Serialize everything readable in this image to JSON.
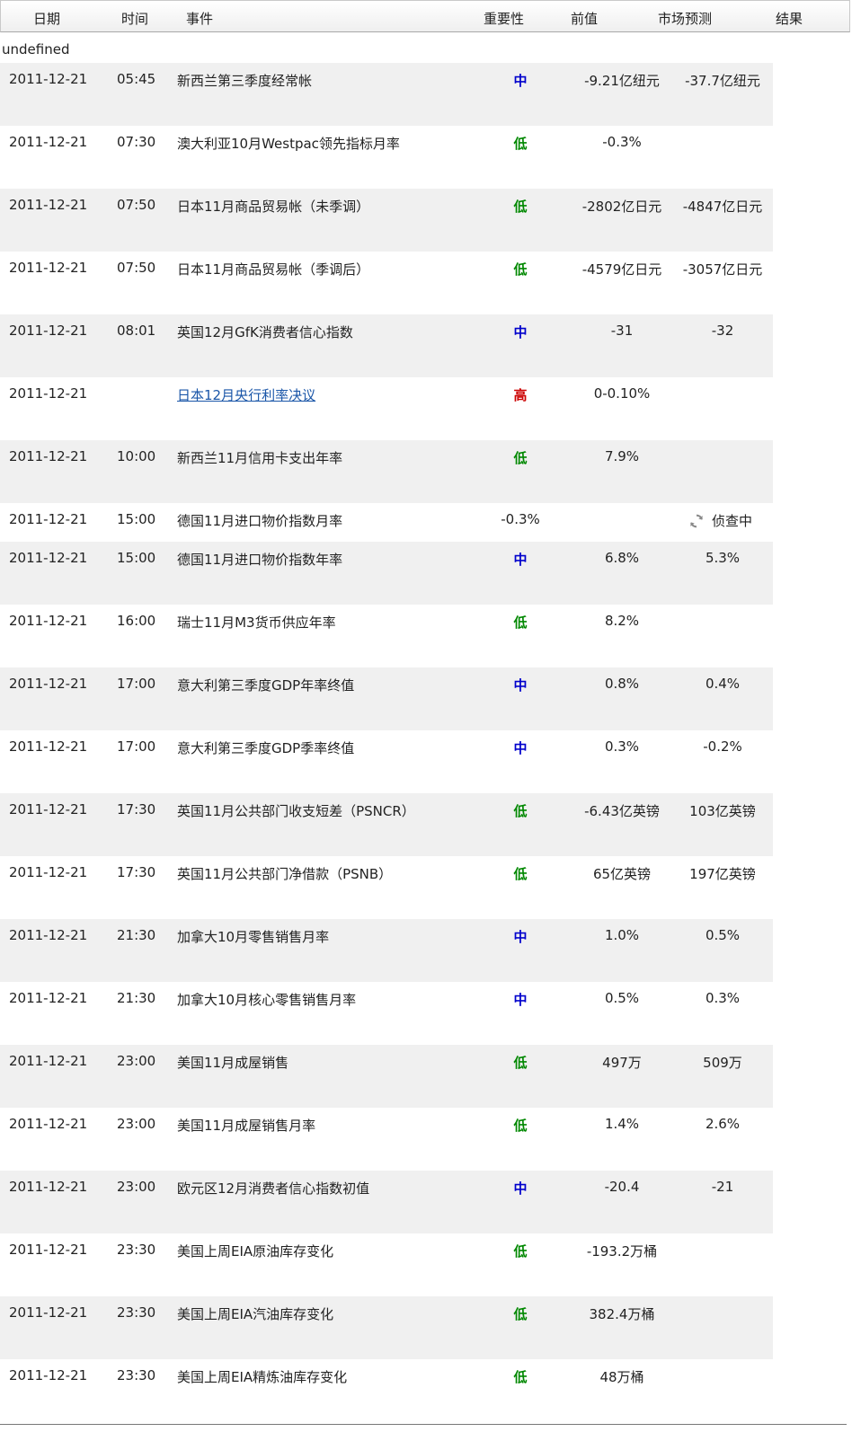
{
  "columns": {
    "date": "日期",
    "time": "时间",
    "event": "事件",
    "importance": "重要性",
    "previous": "前值",
    "forecast": "市场预测",
    "result": "结果"
  },
  "notice": "undefined",
  "colors": {
    "high": "#cc0000",
    "medium": "#0000cc",
    "low": "#008800",
    "link": "#1a56a8",
    "row_alt": "#f0f0f0"
  },
  "rows": [
    {
      "date": "2011-12-21",
      "time": "05:45",
      "event": "新西兰第三季度经常帐",
      "importance": "中",
      "level": "mid",
      "previous": "-9.21亿纽元",
      "forecast": "-37.7亿纽元",
      "result": ""
    },
    {
      "date": "2011-12-21",
      "time": "07:30",
      "event": "澳大利亚10月Westpac领先指标月率",
      "importance": "低",
      "level": "low",
      "previous": "-0.3%",
      "forecast": "",
      "result": ""
    },
    {
      "date": "2011-12-21",
      "time": "07:50",
      "event": "日本11月商品贸易帐（未季调）",
      "importance": "低",
      "level": "low",
      "previous": "-2802亿日元",
      "forecast": "-4847亿日元",
      "result": ""
    },
    {
      "date": "2011-12-21",
      "time": "07:50",
      "event": "日本11月商品贸易帐（季调后）",
      "importance": "低",
      "level": "low",
      "previous": "-4579亿日元",
      "forecast": "-3057亿日元",
      "result": ""
    },
    {
      "date": "2011-12-21",
      "time": "08:01",
      "event": "英国12月GfK消费者信心指数",
      "importance": "中",
      "level": "mid",
      "previous": "-31",
      "forecast": "-32",
      "result": ""
    },
    {
      "date": "2011-12-21",
      "time": "",
      "event": "日本12月央行利率决议",
      "importance": "高",
      "level": "high",
      "previous": "0-0.10%",
      "forecast": "",
      "result": "",
      "link": true
    },
    {
      "date": "2011-12-21",
      "time": "10:00",
      "event": "新西兰11月信用卡支出年率",
      "importance": "低",
      "level": "low",
      "previous": "7.9%",
      "forecast": "",
      "result": ""
    },
    {
      "date": "2011-12-21",
      "time": "15:00",
      "event": "德国11月进口物价指数月率",
      "importance": "-0.3%",
      "level": "plain",
      "previous": "",
      "forecast": "",
      "result": "侦查中",
      "pending": true
    },
    {
      "date": "2011-12-21",
      "time": "15:00",
      "event": "德国11月进口物价指数年率",
      "importance": "中",
      "level": "mid",
      "previous": "6.8%",
      "forecast": "5.3%",
      "result": ""
    },
    {
      "date": "2011-12-21",
      "time": "16:00",
      "event": "瑞士11月M3货币供应年率",
      "importance": "低",
      "level": "low",
      "previous": "8.2%",
      "forecast": "",
      "result": ""
    },
    {
      "date": "2011-12-21",
      "time": "17:00",
      "event": "意大利第三季度GDP年率终值",
      "importance": "中",
      "level": "mid",
      "previous": "0.8%",
      "forecast": "0.4%",
      "result": ""
    },
    {
      "date": "2011-12-21",
      "time": "17:00",
      "event": "意大利第三季度GDP季率终值",
      "importance": "中",
      "level": "mid",
      "previous": "0.3%",
      "forecast": "-0.2%",
      "result": ""
    },
    {
      "date": "2011-12-21",
      "time": "17:30",
      "event": "英国11月公共部门收支短差（PSNCR）",
      "importance": "低",
      "level": "low",
      "previous": "-6.43亿英镑",
      "forecast": "103亿英镑",
      "result": ""
    },
    {
      "date": "2011-12-21",
      "time": "17:30",
      "event": "英国11月公共部门净借款（PSNB）",
      "importance": "低",
      "level": "low",
      "previous": "65亿英镑",
      "forecast": "197亿英镑",
      "result": ""
    },
    {
      "date": "2011-12-21",
      "time": "21:30",
      "event": "加拿大10月零售销售月率",
      "importance": "中",
      "level": "mid",
      "previous": "1.0%",
      "forecast": "0.5%",
      "result": ""
    },
    {
      "date": "2011-12-21",
      "time": "21:30",
      "event": "加拿大10月核心零售销售月率",
      "importance": "中",
      "level": "mid",
      "previous": "0.5%",
      "forecast": "0.3%",
      "result": ""
    },
    {
      "date": "2011-12-21",
      "time": "23:00",
      "event": "美国11月成屋销售",
      "importance": "低",
      "level": "low",
      "previous": "497万",
      "forecast": "509万",
      "result": ""
    },
    {
      "date": "2011-12-21",
      "time": "23:00",
      "event": "美国11月成屋销售月率",
      "importance": "低",
      "level": "low",
      "previous": "1.4%",
      "forecast": "2.6%",
      "result": ""
    },
    {
      "date": "2011-12-21",
      "time": "23:00",
      "event": "欧元区12月消费者信心指数初值",
      "importance": "中",
      "level": "mid",
      "previous": "-20.4",
      "forecast": "-21",
      "result": ""
    },
    {
      "date": "2011-12-21",
      "time": "23:30",
      "event": "美国上周EIA原油库存变化",
      "importance": "低",
      "level": "low",
      "previous": "-193.2万桶",
      "forecast": "",
      "result": ""
    },
    {
      "date": "2011-12-21",
      "time": "23:30",
      "event": "美国上周EIA汽油库存变化",
      "importance": "低",
      "level": "low",
      "previous": "382.4万桶",
      "forecast": "",
      "result": ""
    },
    {
      "date": "2011-12-21",
      "time": "23:30",
      "event": "美国上周EIA精炼油库存变化",
      "importance": "低",
      "level": "low",
      "previous": "48万桶",
      "forecast": "",
      "result": ""
    }
  ]
}
